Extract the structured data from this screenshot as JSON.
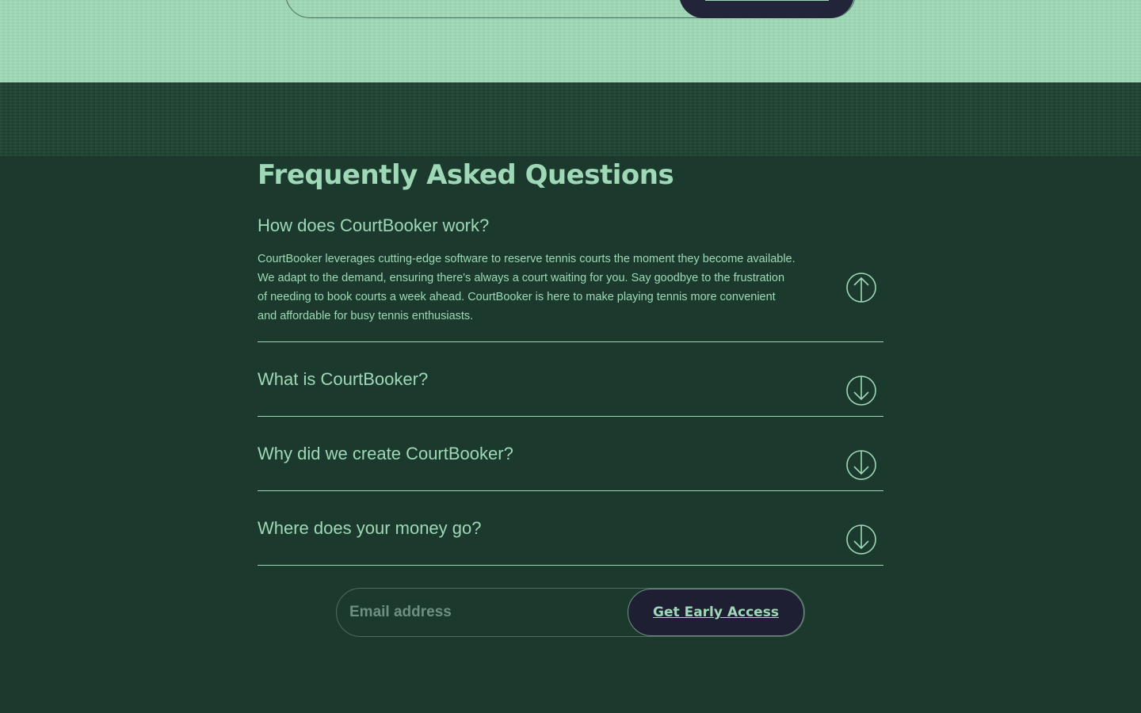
{
  "colors": {
    "accent": "#9ed8b6",
    "background": "#1b3a2d",
    "button_bg": "#1e1f33",
    "top_band": "#9ed8b6"
  },
  "faq": {
    "title": "Frequently Asked Questions",
    "items": [
      {
        "question": "How does CourtBooker work?",
        "answer": "CourtBooker leverages cutting-edge software to reserve tennis courts the moment they become available. We adapt to the demand, ensuring there's always a court waiting for you. Say goodbye to the frustration of needing to book courts a week ahead. CourtBooker is here to make playing tennis more convenient and affordable for busy tennis enthusiasts.",
        "expanded": true,
        "toggle_icon": "arrow-up-circle-icon"
      },
      {
        "question": "What is CourtBooker?",
        "expanded": false,
        "toggle_icon": "arrow-down-circle-icon"
      },
      {
        "question": "Why did we create CourtBooker?",
        "expanded": false,
        "toggle_icon": "arrow-down-circle-icon"
      },
      {
        "question": "Where does your money go?",
        "expanded": false,
        "toggle_icon": "arrow-down-circle-icon"
      }
    ]
  },
  "signup": {
    "email_placeholder": "Email address",
    "email_value": "",
    "cta_label": "Get Early Access"
  }
}
